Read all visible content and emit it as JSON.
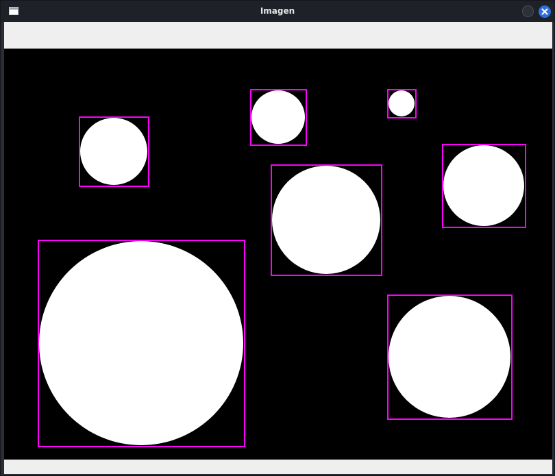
{
  "window": {
    "title": "Imagen",
    "icons": {
      "app": "window-icon",
      "minimize": "minimize-icon",
      "close": "close-icon"
    },
    "colors": {
      "titlebar": "#1f2129",
      "close_button": "#2e6fe0",
      "toolbar": "#efefef",
      "image_background": "#000000",
      "circle_fill": "#ffffff",
      "bounding_box": "#ff00ff"
    }
  },
  "image": {
    "circles": [
      {
        "name": "circle-small-top"
      },
      {
        "name": "circle-top-middle"
      },
      {
        "name": "circle-top-left"
      },
      {
        "name": "circle-right"
      },
      {
        "name": "circle-center"
      },
      {
        "name": "circle-large-bottom-left"
      },
      {
        "name": "circle-bottom-right"
      }
    ]
  }
}
